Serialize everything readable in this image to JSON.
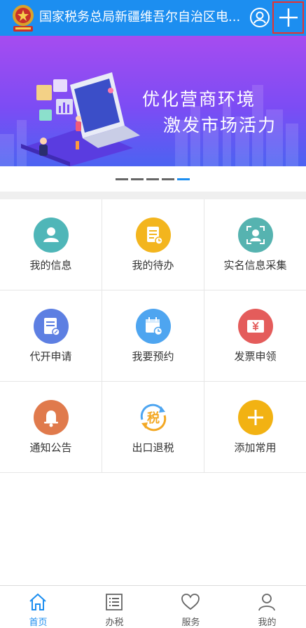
{
  "header": {
    "title": "国家税务总局新疆维吾尔自治区电...",
    "emblem_icon": "tax-emblem-icon",
    "user_icon": "user-circle-icon",
    "add_icon": "plus-icon"
  },
  "banner": {
    "line1": "优化营商环境",
    "line2": "激发市场活力"
  },
  "pager": {
    "count": 5,
    "active_index": 4
  },
  "grid": {
    "items": [
      {
        "label": "我的信息",
        "icon": "person-icon",
        "color": "#4fb6b8"
      },
      {
        "label": "我的待办",
        "icon": "todo-doc-icon",
        "color": "#f3b51e"
      },
      {
        "label": "实名信息采集",
        "icon": "face-scan-icon",
        "color": "#56b3b0"
      },
      {
        "label": "代开申请",
        "icon": "document-edit-icon",
        "color": "#5d7fe2"
      },
      {
        "label": "我要预约",
        "icon": "calendar-clock-icon",
        "color": "#4ea5f0"
      },
      {
        "label": "发票申领",
        "icon": "yuan-invoice-icon",
        "color": "#e45c5b"
      },
      {
        "label": "通知公告",
        "icon": "bell-icon",
        "color": "#e07a4c"
      },
      {
        "label": "出口退税",
        "icon": "tax-refund-icon",
        "color": "#f3a824",
        "glyph": "税"
      },
      {
        "label": "添加常用",
        "icon": "add-icon",
        "color": "#f2b213"
      }
    ]
  },
  "tabbar": {
    "items": [
      {
        "label": "首页",
        "icon": "home-icon",
        "active": true
      },
      {
        "label": "办税",
        "icon": "list-icon",
        "active": false
      },
      {
        "label": "服务",
        "icon": "heart-icon",
        "active": false
      },
      {
        "label": "我的",
        "icon": "person-outline-icon",
        "active": false
      }
    ]
  },
  "colors": {
    "primary": "#1c8ef0",
    "highlight_border": "#e8322e"
  }
}
